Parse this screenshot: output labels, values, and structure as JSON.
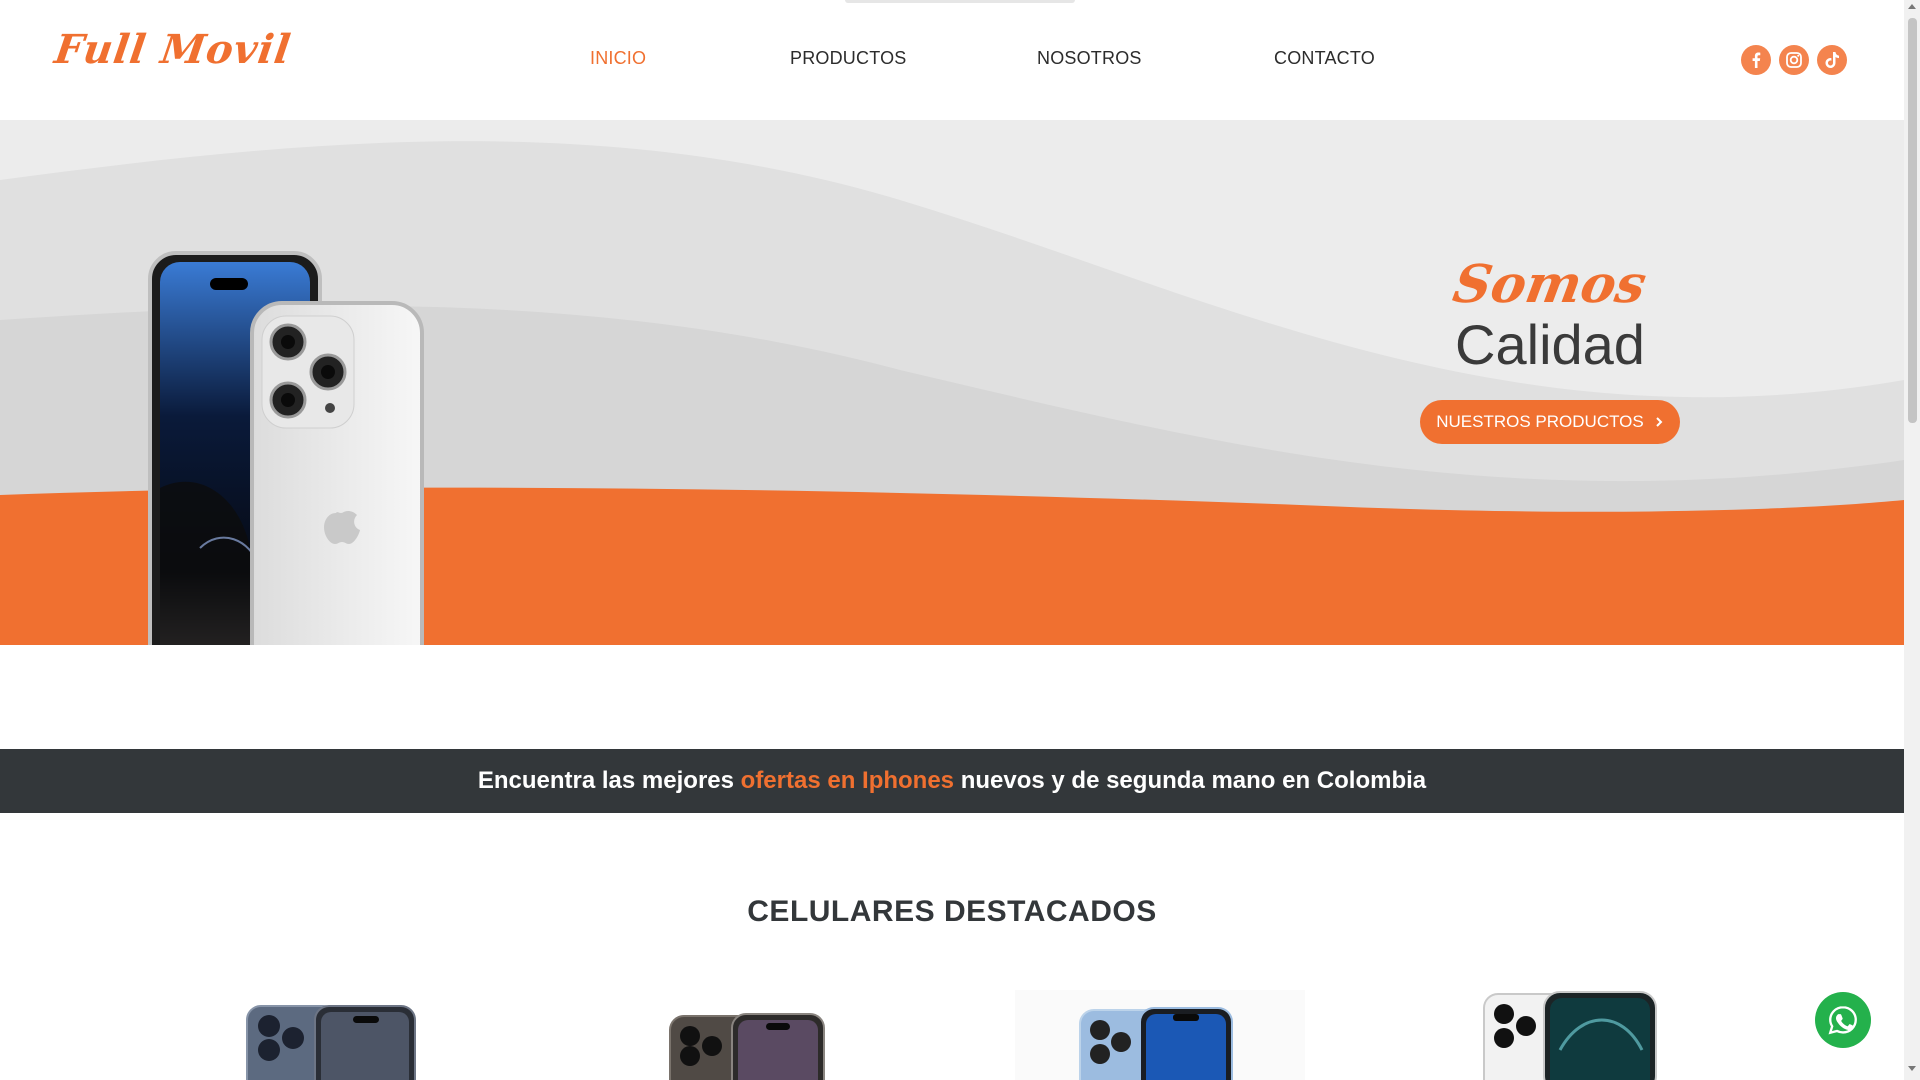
{
  "brand": {
    "logo_text": "Full Movil"
  },
  "nav": {
    "items": [
      {
        "label": "INICIO",
        "active": true
      },
      {
        "label": "PRODUCTOS",
        "active": false
      },
      {
        "label": "NOSOTROS",
        "active": false
      },
      {
        "label": "CONTACTO",
        "active": false
      }
    ]
  },
  "social": [
    "facebook-icon",
    "instagram-icon",
    "tiktok-icon"
  ],
  "hero": {
    "script_title": "Somos",
    "title": "Calidad",
    "cta_label": "NUESTROS PRODUCTOS"
  },
  "banner": {
    "prefix": "Encuentra las mejores",
    "highlight": "ofertas en Iphones",
    "suffix": "nuevos y de segunda mano en Colombia"
  },
  "featured": {
    "title": "CELULARES DESTACADOS"
  },
  "colors": {
    "accent": "#f07030",
    "dark": "#33373a",
    "whatsapp": "#24b14c"
  }
}
